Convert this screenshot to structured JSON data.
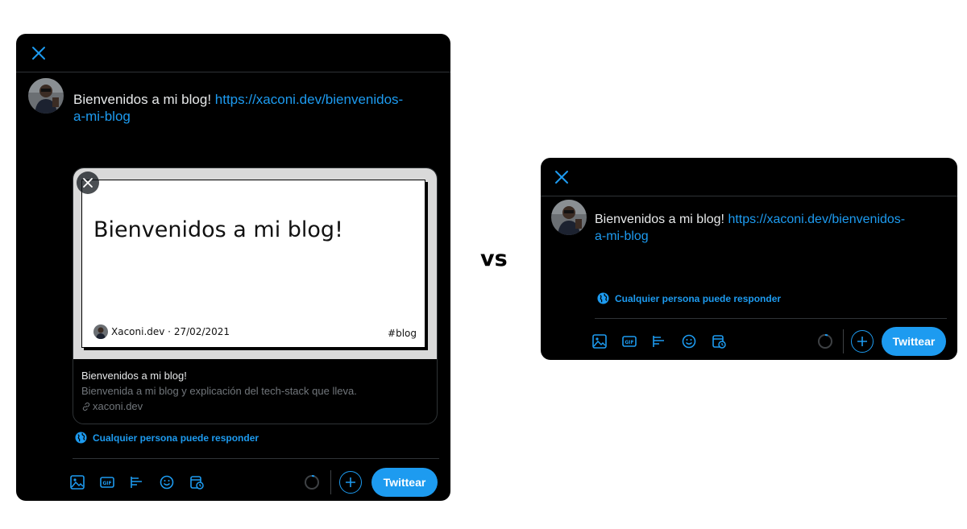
{
  "colors": {
    "accent": "#1d9bf0",
    "background": "#000000",
    "text": "#e7e9ea",
    "muted": "#71767b"
  },
  "composer_a": {
    "close_icon": "close-icon",
    "tweet": {
      "text": "Bienvenidos a mi blog! ",
      "link_line1": "https://xaconi.dev/bienvenidos-",
      "link_line2": "a-mi-blog"
    },
    "card": {
      "preview_title": "Bienvenidos a mi blog!",
      "preview_author": "Xaconi.dev · 27/02/2021",
      "preview_tag": "#blog",
      "title": "Bienvenidos a mi blog!",
      "description": "Bienvenida a mi blog y explicación del tech-stack que lleva.",
      "domain": "xaconi.dev"
    },
    "reply_setting": "Cualquier persona puede responder",
    "tools": [
      "image-icon",
      "gif-icon",
      "poll-icon",
      "emoji-icon",
      "schedule-icon"
    ],
    "tweet_button": "Twittear"
  },
  "vs_label": "vs",
  "composer_b": {
    "close_icon": "close-icon",
    "tweet": {
      "text": "Bienvenidos a mi blog! ",
      "link_line1": "https://xaconi.dev/bienvenidos-",
      "link_line2": "a-mi-blog"
    },
    "reply_setting": "Cualquier persona puede responder",
    "tools": [
      "image-icon",
      "gif-icon",
      "poll-icon",
      "emoji-icon",
      "schedule-icon"
    ],
    "tweet_button": "Twittear"
  }
}
